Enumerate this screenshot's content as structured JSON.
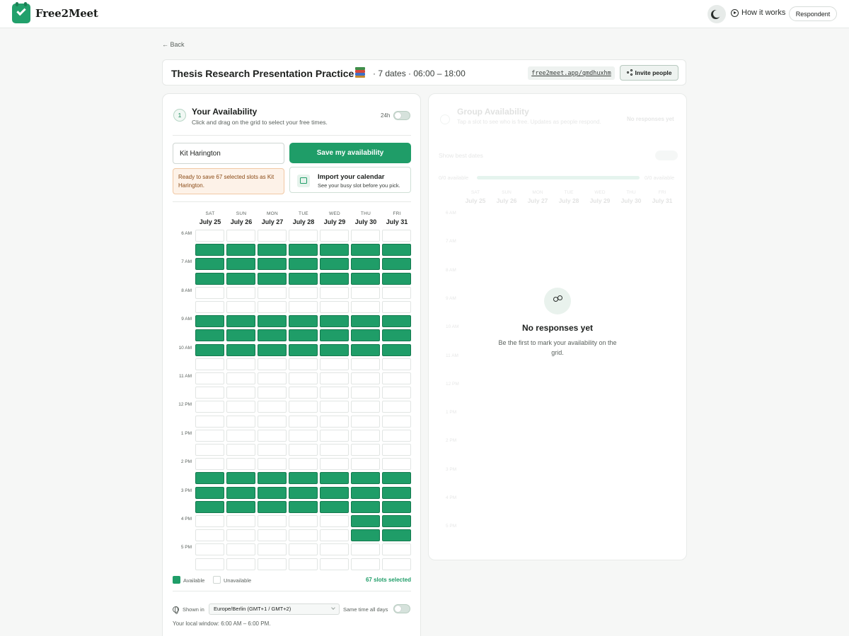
{
  "nav": {
    "logo": "Free2Meet",
    "how_it_works": "How it works",
    "role_button": "Respondent"
  },
  "back": "← Back",
  "event": {
    "title": "Thesis Research Presentation Practice",
    "meta": "· 7 dates · 06:00 – 18:00",
    "share_url": "free2meet.app/qmdhuxhm",
    "invite_label": "Invite people"
  },
  "availability": {
    "step": "1",
    "title": "Your Availability",
    "subtitle": "Click and drag on the grid to select your free times.",
    "toggle_24h_label": "24h",
    "name_value": "Kit Harington",
    "save_label": "Save my availability",
    "notice": "Ready to save 67 selected slots as Kit Harington.",
    "import_title": "Import your calendar",
    "import_sub": "See your busy slot before you pick.",
    "days": [
      {
        "dow": "SAT",
        "date": "July 25"
      },
      {
        "dow": "SUN",
        "date": "July 26"
      },
      {
        "dow": "MON",
        "date": "July 27"
      },
      {
        "dow": "TUE",
        "date": "July 28"
      },
      {
        "dow": "WED",
        "date": "July 29"
      },
      {
        "dow": "THU",
        "date": "July 30"
      },
      {
        "dow": "FRI",
        "date": "July 31"
      }
    ],
    "hours": [
      "6 AM",
      "7 AM",
      "8 AM",
      "9 AM",
      "10 AM",
      "11 AM",
      "12 PM",
      "1 PM",
      "2 PM",
      "3 PM",
      "4 PM",
      "5 PM"
    ],
    "selected_rows_all_days": [
      1,
      2,
      3,
      6,
      7,
      8,
      17,
      18,
      19
    ],
    "selected_rows_thu_fri": [
      20,
      21
    ],
    "legend_available": "Available",
    "legend_unavailable": "Unavailable",
    "slots_selected": "67 slots selected",
    "shown_in_label": "Shown in",
    "timezone": "Europe/Berlin (GMT+1 / GMT+2)",
    "same_time_label": "Same time all days",
    "local_window": "Your local window: 6:00 AM – 6:00 PM.",
    "colors": {
      "available": "#1f9d68",
      "accent": "#1f9d68"
    }
  },
  "group": {
    "title": "Group Availability",
    "subtitle": "Tap a slot to see who is free. Updates as people respond.",
    "no_responses_badge": "No responses yet",
    "show_best": "Show best dates",
    "avail_left": "0/0 available",
    "avail_right": "0/0 available",
    "days": [
      {
        "dow": "SAT",
        "date": "July 25"
      },
      {
        "dow": "SUN",
        "date": "July 26"
      },
      {
        "dow": "MON",
        "date": "July 27"
      },
      {
        "dow": "TUE",
        "date": "July 28"
      },
      {
        "dow": "WED",
        "date": "July 29"
      },
      {
        "dow": "THU",
        "date": "July 30"
      },
      {
        "dow": "FRI",
        "date": "July 31"
      }
    ],
    "hours": [
      "6 AM",
      "7 AM",
      "8 AM",
      "9 AM",
      "10 AM",
      "11 AM",
      "12 PM",
      "1 PM",
      "2 PM",
      "3 PM",
      "4 PM",
      "5 PM"
    ],
    "empty_title": "No responses yet",
    "empty_sub": "Be the first to mark your availability on the grid."
  }
}
